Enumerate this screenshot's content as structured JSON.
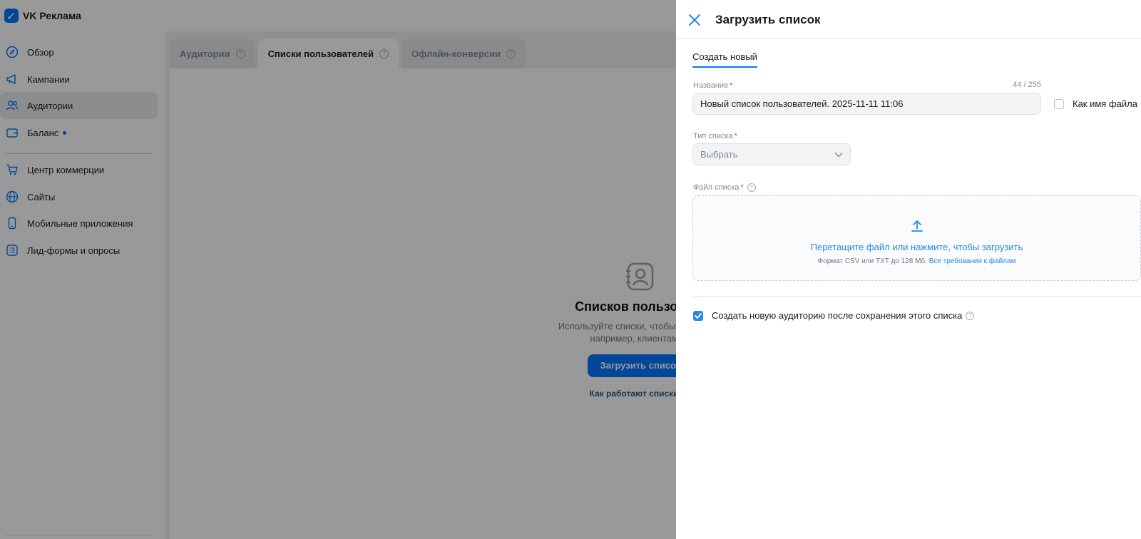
{
  "app": {
    "logo_text": "VK Реклама",
    "brand_color": "#0077ff",
    "overlay_color": "rgba(0,0,0,0.40)"
  },
  "sidebar": {
    "items": [
      {
        "label": "Обзор",
        "icon": "compass-icon"
      },
      {
        "label": "Кампании",
        "icon": "megaphone-icon"
      },
      {
        "label": "Аудитории",
        "icon": "users-icon",
        "active": true
      },
      {
        "label": "Баланс",
        "icon": "wallet-icon",
        "has_dot": true
      },
      {
        "label": "Центр коммерции",
        "icon": "cart-icon"
      },
      {
        "label": "Сайты",
        "icon": "globe-icon"
      },
      {
        "label": "Мобильные приложения",
        "icon": "phone-icon"
      },
      {
        "label": "Лид-формы и опросы",
        "icon": "form-icon"
      }
    ]
  },
  "tabs": [
    {
      "label": "Аудитории"
    },
    {
      "label": "Списки пользователей",
      "active": true
    },
    {
      "label": "Офлайн-конверсии"
    }
  ],
  "empty_state": {
    "title": "Списков пользовате",
    "desc_line1": "Используйте списки, чтобы показыват",
    "desc_line2": "например, клиентам ва",
    "button": "Загрузить список",
    "link": "Как работают списки по"
  },
  "drawer": {
    "title": "Загрузить список",
    "tab": "Создать новый",
    "name_label": "Название",
    "name_counter": "44 / 255",
    "name_value": "Новый список пользователей. 2025-11-11 11:06",
    "as_filename_label": "Как имя файла",
    "type_label": "Тип списка",
    "type_placeholder": "Выбрать",
    "file_label": "Файл списка",
    "dropzone_main": "Перетащите файл или нажмите, чтобы загрузить",
    "dropzone_format": "Формат CSV или TXT до 128 Мб.",
    "dropzone_link": "Все требования к файлам",
    "create_audience_label": "Создать новую аудиторию после сохранения этого списка",
    "create_audience_checked": true,
    "required_mark": "*"
  }
}
